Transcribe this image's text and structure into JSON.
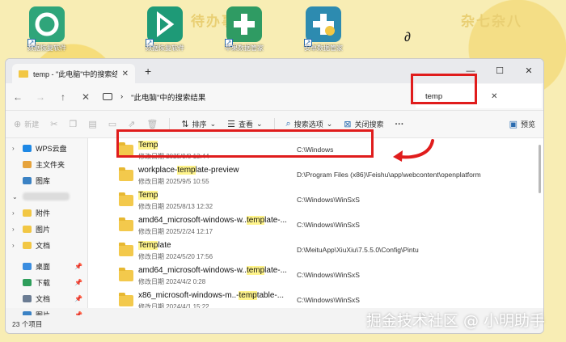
{
  "desktop": {
    "bg_texts": [
      "待办事",
      "杂七杂八"
    ],
    "icons": [
      {
        "label": "数据恢复软件",
        "color": "#2fa57a"
      },
      {
        "label": "数据恢复软件",
        "color": "#1e9a77"
      },
      {
        "label": "苹果数据管家",
        "color": "#2f9b63"
      },
      {
        "label": "安卓数据管家",
        "color": "#2d8bb0"
      }
    ]
  },
  "window": {
    "tab_title": "temp - \"此电脑\"中的搜索结果",
    "path": "\"此电脑\"中的搜索结果",
    "search_value": "temp"
  },
  "toolbar": {
    "new": "新建",
    "sort": "排序",
    "view": "查看",
    "search_options": "搜索选项",
    "close_search": "关闭搜索",
    "more": "···",
    "preview": "预览"
  },
  "nav": {
    "items": [
      {
        "label": "WPS云盘",
        "color": "#1e88e5",
        "chev": "›"
      },
      {
        "label": "主文件夹",
        "color": "#e6a33c",
        "chev": ""
      },
      {
        "label": "图库",
        "color": "#3b82c4",
        "chev": ""
      },
      {
        "label": "",
        "color": "",
        "chev": "⌄"
      },
      {
        "label": "附件",
        "color": "#f2c744",
        "chev": "›"
      },
      {
        "label": "图片",
        "color": "#f2c744",
        "chev": "›"
      },
      {
        "label": "文档",
        "color": "#f2c744",
        "chev": "›"
      },
      {
        "label": "桌面",
        "color": "#3a8de0",
        "chev": ""
      },
      {
        "label": "下载",
        "color": "#2e9e5b",
        "chev": ""
      },
      {
        "label": "文档",
        "color": "#6b7c93",
        "chev": ""
      },
      {
        "label": "图片",
        "color": "#3b82c4",
        "chev": ""
      }
    ]
  },
  "files": [
    {
      "pre": "",
      "hl": "Temp",
      "post": "",
      "date": "修改日期 2025/9/8 13:44",
      "path": "C:\\Windows"
    },
    {
      "pre": "workplace-",
      "hl": "temp",
      "post": "late-preview",
      "date": "修改日期 2025/9/5 10:55",
      "path": "D:\\Program Files (x86)\\Feishu\\app\\webcontent\\openplatform"
    },
    {
      "pre": "",
      "hl": "Temp",
      "post": "",
      "date": "修改日期 2025/8/13 12:32",
      "path": "C:\\Windows\\WinSxS"
    },
    {
      "pre": "amd64_microsoft-windows-w..",
      "hl": "temp",
      "post": "late-...",
      "date": "修改日期 2025/2/24 12:17",
      "path": "C:\\Windows\\WinSxS"
    },
    {
      "pre": "",
      "hl": "Temp",
      "post": "late",
      "date": "修改日期 2024/5/20 17:56",
      "path": "D:\\MeituApp\\XiuXiu\\7.5.5.0\\Config\\Pintu"
    },
    {
      "pre": "amd64_microsoft-windows-w..",
      "hl": "temp",
      "post": "late-...",
      "date": "修改日期 2024/4/2 0:28",
      "path": "C:\\Windows\\WinSxS"
    },
    {
      "pre": "x86_microsoft-windows-m..-",
      "hl": "temp",
      "post": "table-...",
      "date": "修改日期 2024/4/1 15:22",
      "path": "C:\\Windows\\WinSxS"
    }
  ],
  "status": "23 个项目",
  "watermark": "掘金技术社区 @ 小明助手"
}
